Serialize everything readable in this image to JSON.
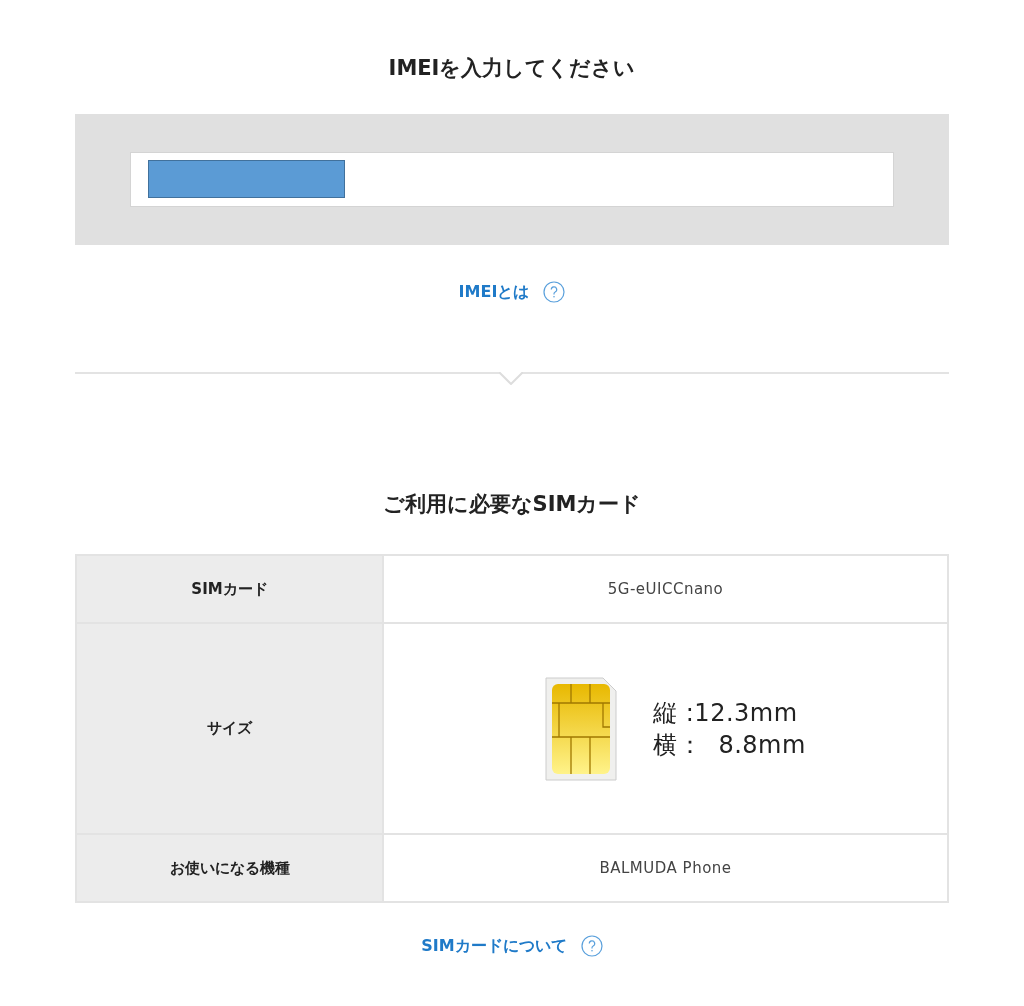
{
  "imei_section": {
    "title": "IMEIを入力してください",
    "input": {
      "redacted": true
    },
    "help_link": "IMEIとは"
  },
  "sim_section": {
    "title": "ご利用に必要なSIMカード",
    "rows": [
      {
        "kind": "text",
        "label": "SIMカード",
        "value": "5G-eUICCnano"
      },
      {
        "kind": "size",
        "label": "サイズ",
        "lines": [
          "縦 :12.3mm",
          "横：  8.8mm"
        ]
      },
      {
        "kind": "text",
        "label": "お使いになる機種",
        "value": "BALMUDA Phone"
      }
    ],
    "help_link": "SIMカードについて"
  }
}
